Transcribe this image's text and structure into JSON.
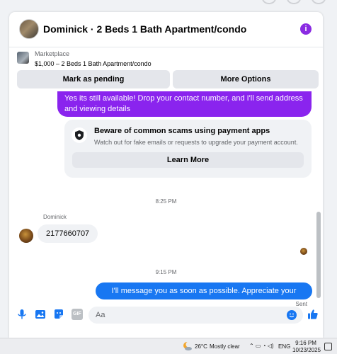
{
  "header": {
    "title": "Dominick · 2 Beds 1 Bath Apartment/condo",
    "info_icon": "info-icon"
  },
  "listing": {
    "source": "Marketplace",
    "summary": "$1,000 – 2 Beds 1 Bath Apartment/condo"
  },
  "actions": {
    "pending_label": "Mark as pending",
    "more_label": "More Options"
  },
  "messages": {
    "outgoing_1": "Yes its still available! Drop your contact number, and I'll send address and viewing details",
    "scam_title": "Beware of common scams using payment apps",
    "scam_body": "Watch out for fake emails or requests to upgrade your payment account.",
    "learn_more": "Learn More",
    "time_1": "8:25 PM",
    "sender_name": "Dominick",
    "incoming_1": "2177660707",
    "time_2": "9:15 PM",
    "outgoing_2": "I'll message you as soon as possible. Appreciate your patience",
    "status": "Sent"
  },
  "composer": {
    "placeholder": "Aa",
    "icons": [
      "microphone-icon",
      "image-icon",
      "sticker-icon",
      "gif-icon",
      "emoji-icon",
      "like-icon"
    ],
    "gif_label": "GIF"
  },
  "taskbar": {
    "temperature": "26°C",
    "condition": "Mostly clear",
    "language": "ENG",
    "time": "9:16 PM",
    "date": "10/23/2025"
  },
  "colors": {
    "outgoing_purple": "#8a24ee",
    "outgoing_blue": "#1877f2",
    "accent_blue": "#1877f2",
    "info_purple": "#8a2be2"
  }
}
